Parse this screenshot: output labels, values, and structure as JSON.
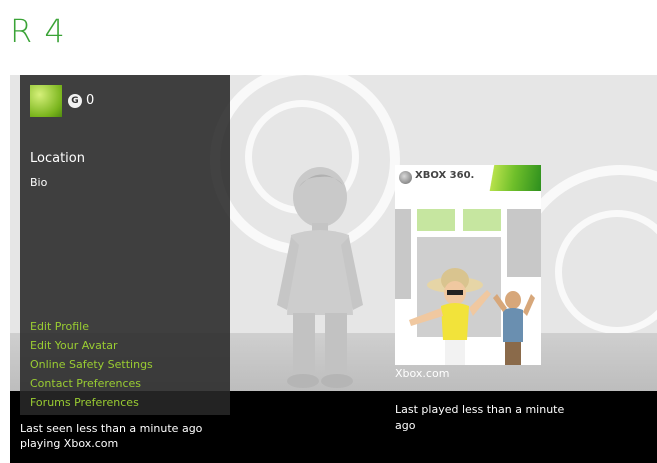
{
  "profile": {
    "gamertag": "R 4",
    "gamerscore": "0",
    "gamerscore_icon": "G",
    "location_label": "Location",
    "bio_label": "Bio",
    "last_seen": "Last seen less than a minute ago playing Xbox.com"
  },
  "menu": [
    {
      "label": "Edit Profile"
    },
    {
      "label": "Edit Your Avatar"
    },
    {
      "label": "Online Safety Settings"
    },
    {
      "label": "Contact Preferences"
    },
    {
      "label": "Forums Preferences"
    }
  ],
  "game": {
    "brand": "XBOX 360.",
    "name": "Xbox.com",
    "last_played": "Last played less than a minute ago"
  },
  "colors": {
    "gamertag": "#3aa336",
    "link": "#9acd32",
    "panel": "#282828",
    "background": "#e6e6e6"
  }
}
